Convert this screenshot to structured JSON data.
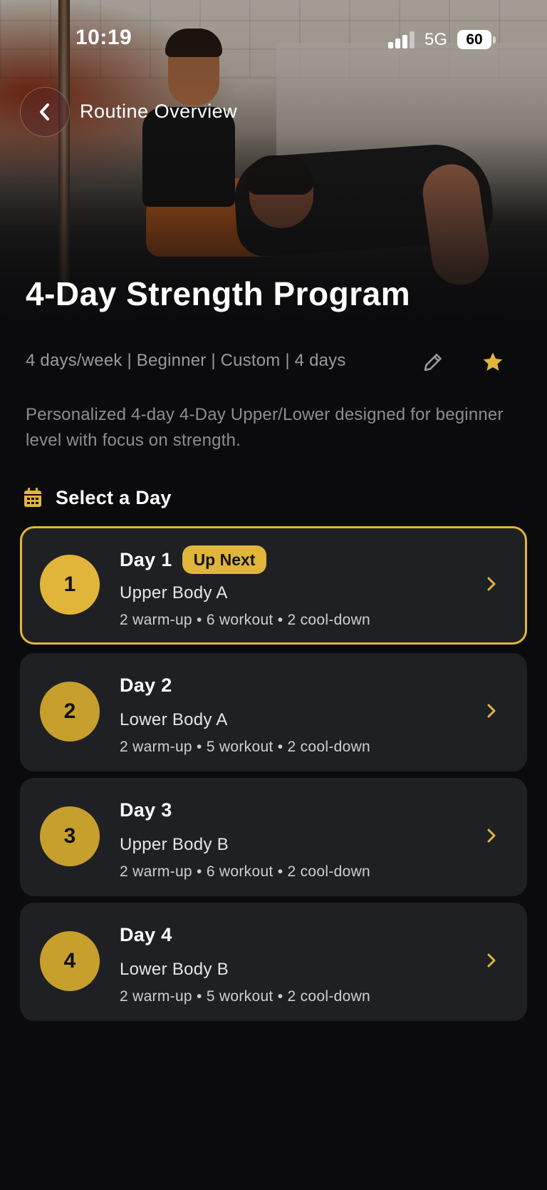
{
  "status_bar": {
    "time": "10:19",
    "network": "5G",
    "battery": "60"
  },
  "nav": {
    "title": "Routine Overview",
    "back_icon": "chevron-left-icon"
  },
  "program": {
    "title": "4-Day Strength Program",
    "meta": "4 days/week | Beginner | Custom | 4 days",
    "description": "Personalized 4-day 4-Day Upper/Lower designed for beginner level with focus on strength.",
    "edit_icon": "pencil-icon",
    "favorite_icon": "star-icon"
  },
  "section": {
    "title": "Select a Day",
    "icon": "calendar-icon"
  },
  "days": [
    {
      "number": "1",
      "name": "Day 1",
      "badge": "Up Next",
      "subtitle": "Upper Body A",
      "breakdown": "2 warm-up • 6 workout • 2 cool-down"
    },
    {
      "number": "2",
      "name": "Day 2",
      "subtitle": "Lower Body A",
      "breakdown": "2 warm-up • 5 workout • 2 cool-down"
    },
    {
      "number": "3",
      "name": "Day 3",
      "subtitle": "Upper Body B",
      "breakdown": "2 warm-up • 6 workout • 2 cool-down"
    },
    {
      "number": "4",
      "name": "Day 4",
      "subtitle": "Lower Body B",
      "breakdown": "2 warm-up • 5 workout • 2 cool-down"
    }
  ],
  "colors": {
    "accent": "#e0b53a",
    "card_bg": "#1f2024",
    "page_bg": "#0b0b0d",
    "muted_text": "#9a9a9e"
  }
}
